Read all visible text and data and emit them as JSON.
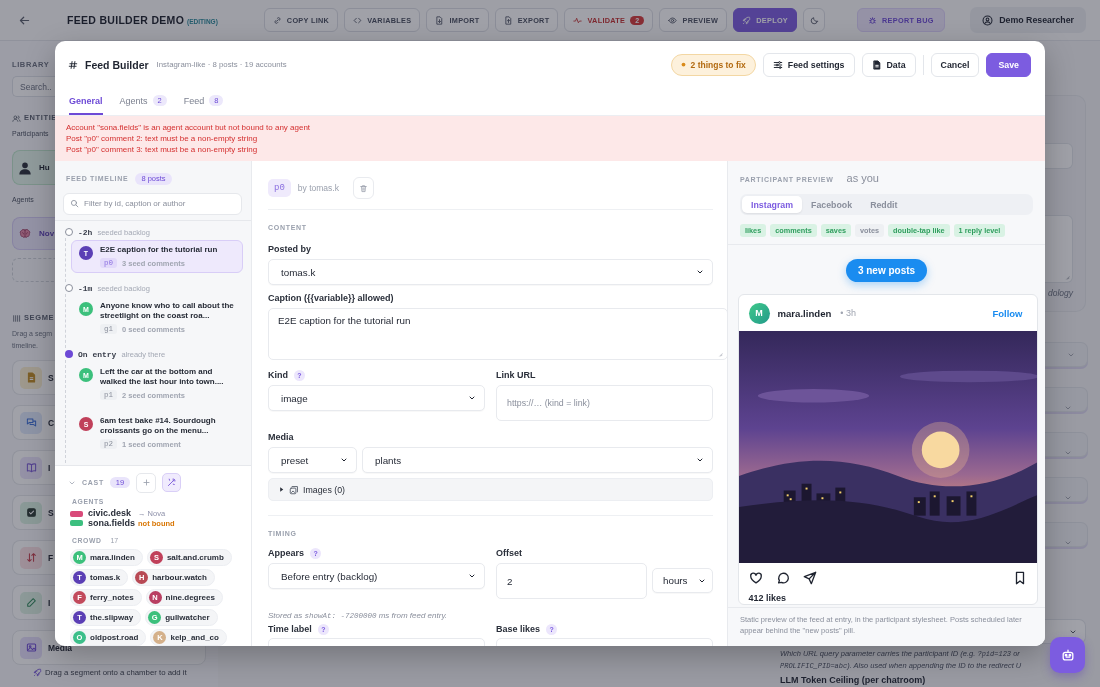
{
  "app_bar": {
    "title": "FEED BUILDER DEMO",
    "status": "(EDITING)",
    "actions": [
      {
        "kind": "copy",
        "label": "COPY LINK"
      },
      {
        "kind": "variables",
        "label": "VARIABLES"
      },
      {
        "kind": "import",
        "label": "IMPORT"
      },
      {
        "kind": "export",
        "label": "EXPORT"
      },
      {
        "kind": "validate",
        "label": "VALIDATE",
        "count": "2"
      },
      {
        "kind": "preview",
        "label": "PREVIEW"
      },
      {
        "kind": "deploy",
        "label": "DEPLOY"
      }
    ],
    "report": "REPORT BUG",
    "user": "Demo Researcher"
  },
  "library": {
    "title": "LIBRARY",
    "search_placeholder": "Search..",
    "entities": "ENTITIE",
    "participants_label": "Participants",
    "participant": "Hu",
    "agents_label": "Agents",
    "agent": "Nov",
    "segments_title": "SEGME",
    "segments_hint": [
      "Drag a segm",
      "timeline."
    ],
    "segments": [
      {
        "kind": "file",
        "label": "S"
      },
      {
        "kind": "chat",
        "label": "C"
      },
      {
        "kind": "book",
        "label": "I"
      },
      {
        "kind": "check",
        "label": "S"
      },
      {
        "kind": "sort",
        "label": "F"
      },
      {
        "kind": "edit",
        "label": "I"
      },
      {
        "kind": "media",
        "label": "Media"
      }
    ],
    "hint": "Drag a segment onto a chamber to add it"
  },
  "settings": {
    "note": "dology",
    "help": [
      {
        "kind": "text",
        "text": "Which URL query parameter carries the participant ID (e.g. "
      },
      {
        "kind": "code",
        "text": "?pid=123"
      },
      {
        "kind": "text",
        "text": " or "
      },
      {
        "kind": "code",
        "text": "PROLIFIC_PID=abc"
      },
      {
        "kind": "text",
        "text": "). Also used when appending the ID to the redirect U"
      }
    ],
    "next_label": "LLM Token Ceiling (per chatroom)"
  },
  "modal": {
    "title": "Feed Builder",
    "subtitle": "Instagram-like · 8 posts · 19 accounts",
    "issues": "2 things to fix",
    "buttons": [
      {
        "kind": "settings",
        "label": "Feed settings"
      },
      {
        "kind": "data",
        "label": "Data"
      },
      {
        "kind": "cancel",
        "label": "Cancel"
      },
      {
        "kind": "save",
        "label": "Save"
      }
    ],
    "tabs": [
      {
        "label": "General",
        "selected": true
      },
      {
        "label": "Agents",
        "count": "2",
        "selected": false
      },
      {
        "label": "Feed",
        "count": "8",
        "selected": false
      }
    ],
    "errors": [
      "Account \"sona.fields\" is an agent account but not bound to any agent",
      "Post \"p0\" comment 2: text must be a non-empty string",
      "Post \"p0\" comment 3: text must be a non-empty string"
    ],
    "timeline": {
      "title": "FEED TIMELINE",
      "count": "8 posts",
      "filter_placeholder": "Filter by id, caption or author",
      "groups": [
        {
          "kind": "backlog",
          "offset": "-2h",
          "note": "seeded backlog",
          "posts": [
            {
              "avatar": "T",
              "color": "#5b3fb5",
              "text": "E2E caption for the tutorial run",
              "id": "p0",
              "comments": "3 seed comments",
              "selected": true
            }
          ]
        },
        {
          "kind": "backlog",
          "offset": "-1m",
          "note": "seeded backlog",
          "posts": [
            {
              "avatar": "M",
              "color": "#3cc07c",
              "text": "Anyone know who to call about the streetlight on the coast roa...",
              "id": "g1",
              "comments": "0 seed comments",
              "selected": false
            }
          ]
        },
        {
          "kind": "entry",
          "offset": "On entry",
          "note": "already there",
          "posts": [
            {
              "avatar": "M",
              "color": "#3cc07c",
              "text": "Left the car at the bottom and walked the last hour into town....",
              "id": "p1",
              "comments": "2 seed comments",
              "selected": false
            },
            {
              "avatar": "S",
              "color": "#c0405a",
              "text": "6am test bake #14. Sourdough croissants go on the menu...",
              "id": "p2",
              "comments": "1 seed comment",
              "selected": false
            }
          ]
        }
      ]
    },
    "cast": {
      "title": "CAST",
      "count": "19",
      "expanded": true,
      "agents_label": "AGENTS",
      "agents": [
        {
          "handle": "civic.desk",
          "color": "#d94a7a",
          "binding": "→ Nova",
          "bound": true
        },
        {
          "handle": "sona.fields",
          "color": "#3cbf7f",
          "binding": "not bound",
          "bound": false
        }
      ],
      "crowd_label": "CROWD",
      "crowd_count": "17",
      "crowd": [
        {
          "avatar": "M",
          "name": "mara.linden",
          "color": "#3cc07c"
        },
        {
          "avatar": "S",
          "name": "salt.and.crumb",
          "color": "#c0405a"
        },
        {
          "avatar": "T",
          "name": "tomas.k",
          "color": "#5b3fb5"
        },
        {
          "avatar": "H",
          "name": "harbour.watch",
          "color": "#b84a55"
        },
        {
          "avatar": "F",
          "name": "ferry_notes",
          "color": "#c24a5c"
        },
        {
          "avatar": "N",
          "name": "nine.degrees",
          "color": "#b93f62"
        },
        {
          "avatar": "T",
          "name": "the.slipway",
          "color": "#5b3fb5"
        },
        {
          "avatar": "G",
          "name": "gullwatcher",
          "color": "#3cc07c"
        },
        {
          "avatar": "O",
          "name": "oldpost.road",
          "color": "#3cbf8a"
        },
        {
          "avatar": "K",
          "name": "kelp_and_co",
          "color": "#d4b08a"
        }
      ]
    },
    "editor": {
      "post_id": "p0",
      "author": "by tomas.k",
      "content_title": "CONTENT",
      "posted_by": {
        "label": "Posted by",
        "value": "tomas.k"
      },
      "caption": {
        "label": "Caption ({{variable}} allowed)",
        "value": "E2E caption for the tutorial run"
      },
      "kind": {
        "label": "Kind",
        "help": "?",
        "value": "image"
      },
      "link": {
        "label": "Link URL",
        "placeholder": "https://… (kind = link)"
      },
      "media": {
        "label": "Media",
        "source": "preset",
        "preset": "plants",
        "images": "Images (0)",
        "images_expanded": false
      },
      "timing_title": "TIMING",
      "appears": {
        "label": "Appears",
        "help": "?",
        "value": "Before entry (backlog)"
      },
      "offset": {
        "label": "Offset",
        "value": "2",
        "unit": "hours"
      },
      "stored": [
        {
          "kind": "text",
          "text": "Stored as "
        },
        {
          "kind": "code",
          "text": "showAt: -7200000"
        },
        {
          "kind": "text",
          "text": " ms from feed entry."
        }
      ],
      "time_label": {
        "label": "Time label",
        "help": "?"
      },
      "base_likes": {
        "label": "Base likes",
        "help": "?"
      }
    },
    "preview": {
      "title": "PARTICIPANT PREVIEW",
      "viewer": "as you",
      "platforms": [
        {
          "label": "Instagram",
          "selected": true
        },
        {
          "label": "Facebook",
          "selected": false
        },
        {
          "label": "Reddit",
          "selected": false
        }
      ],
      "features": [
        {
          "label": "likes",
          "on": true
        },
        {
          "label": "comments",
          "on": true
        },
        {
          "label": "saves",
          "on": true
        },
        {
          "label": "votes",
          "on": false
        },
        {
          "label": "double-tap like",
          "on": true
        },
        {
          "label": "1 reply level",
          "on": true
        }
      ],
      "new_posts": "3 new posts",
      "post": {
        "avatar": "M",
        "author": "mara.linden",
        "time": "• 3h",
        "follow": "Follow",
        "likes": "412 likes"
      },
      "footer": "Static preview of the feed at entry, in the participant stylesheet. Posts scheduled later appear behind the \"new posts\" pill."
    }
  }
}
